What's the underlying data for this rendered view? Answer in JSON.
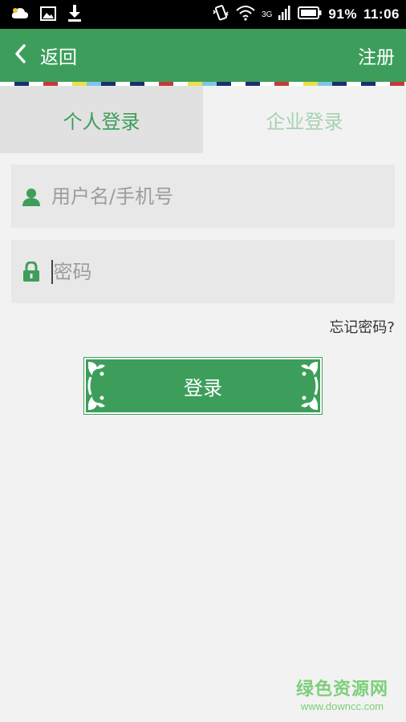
{
  "status_bar": {
    "battery_percent": "91%",
    "time": "11:06",
    "network": "3G",
    "icons": [
      "cloud-icon",
      "image-icon",
      "download-icon",
      "vibrate-icon",
      "wifi-icon",
      "signal-icon",
      "battery-icon"
    ]
  },
  "header": {
    "back_label": "返回",
    "register_label": "注册",
    "color": "#3d9e5b"
  },
  "tabs": [
    {
      "label": "个人登录",
      "active": true
    },
    {
      "label": "企业登录",
      "active": false
    }
  ],
  "form": {
    "username_placeholder": "用户名/手机号",
    "password_placeholder": "密码",
    "forgot_label": "忘记密码?",
    "login_label": "登录"
  },
  "watermark": {
    "title": "绿色资源网",
    "url": "www.downcc.com"
  }
}
